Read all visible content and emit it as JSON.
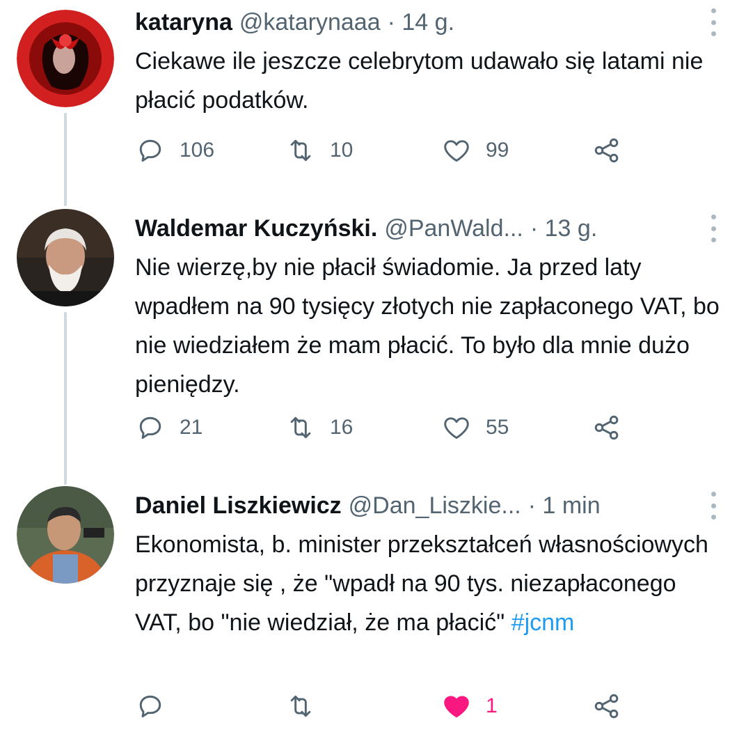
{
  "tweets": [
    {
      "name": "kataryna",
      "handle": "@katarynaaa",
      "time": "· 14 g.",
      "text": "Ciekawe ile jeszcze celebrytom udawało się latami nie płacić podatków.",
      "hashtag": "",
      "replies": "106",
      "retweets": "10",
      "likes": "99",
      "liked": false
    },
    {
      "name": "Waldemar Kuczyński.",
      "handle": "@PanWald...",
      "time": "· 13 g.",
      "text": "Nie wierzę,by nie płacił świadomie. Ja przed laty wpadłem na 90 tysięcy złotych nie zapłaconego VAT, bo nie wiedziałem że mam płacić. To było dla mnie dużo pieniędzy.",
      "hashtag": "",
      "replies": "21",
      "retweets": "16",
      "likes": "55",
      "liked": false
    },
    {
      "name": "Daniel Liszkiewicz",
      "handle": "@Dan_Liszkie...",
      "time": "· 1 min",
      "text": "Ekonomista, b. minister przekształceń własnościowych przyznaje się , że \"wpadł na 90 tys. niezapłaconego VAT, bo \"nie wiedział, że ma płacić\"",
      "hashtag": "#jcnm",
      "replies": "",
      "retweets": "",
      "likes": "1",
      "liked": true
    }
  ],
  "colors": {
    "text": "#0f1419",
    "secondary": "#536471",
    "hashtag": "#1d9bf0",
    "like_active": "#f91880",
    "thread_line": "#cfd9de"
  },
  "icons": [
    "reply-icon",
    "retweet-icon",
    "like-icon",
    "share-icon",
    "more-options-icon"
  ]
}
